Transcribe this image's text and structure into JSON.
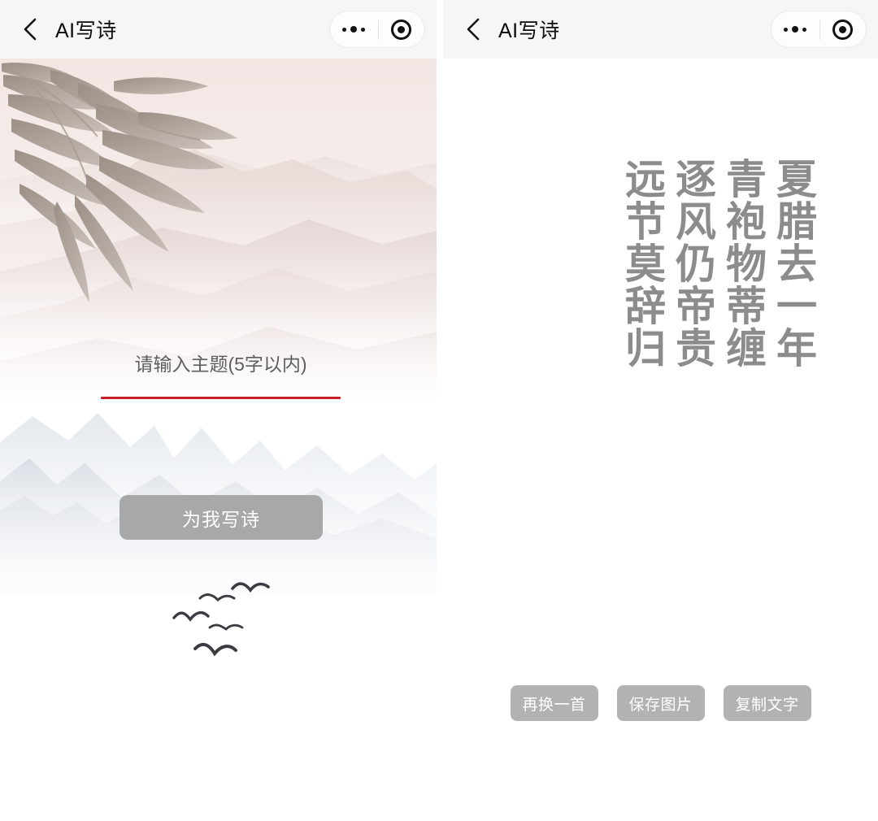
{
  "app": {
    "title": "AI写诗"
  },
  "header": {
    "back_icon": "chevron-left-icon",
    "title": "AI写诗",
    "capsule": {
      "more_icon": "more-dots-icon",
      "target_icon": "target-circle-icon"
    }
  },
  "left_screen": {
    "topic_input": {
      "value": "",
      "placeholder": "请输入主题(5字以内)",
      "underline_color": "#c3202b"
    },
    "write_button": {
      "label": "为我写诗",
      "background": "#a8a8a8",
      "text_color": "#ffffff"
    },
    "scenery": {
      "bamboo": "bamboo-leaves",
      "mountains": "ink-wash-mountains",
      "birds": "flying-birds",
      "top_tint": "#efe3e0",
      "bottom_tint": "#dfe4ea"
    }
  },
  "right_screen": {
    "poem": {
      "columns": [
        "夏腊去一年",
        "青袍物蒂缠",
        "逐风仍帝贵",
        "远节莫辞归"
      ],
      "text_color": "#8c8c8c"
    },
    "actions": [
      {
        "label": "再换一首",
        "name": "regenerate-poem-button"
      },
      {
        "label": "保存图片",
        "name": "save-image-button"
      },
      {
        "label": "复制文字",
        "name": "copy-text-button"
      }
    ]
  }
}
